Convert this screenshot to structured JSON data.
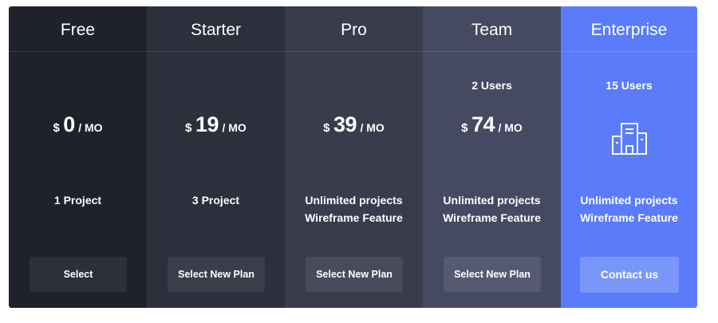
{
  "plans": [
    {
      "name": "Free",
      "users": "",
      "currency": "$",
      "amount": "0",
      "period": "/ MO",
      "features": [
        "1 Project"
      ],
      "button_label": "Select"
    },
    {
      "name": "Starter",
      "users": "",
      "currency": "$",
      "amount": "19",
      "period": "/ MO",
      "features": [
        "3 Project"
      ],
      "button_label": "Select New Plan"
    },
    {
      "name": "Pro",
      "users": "",
      "currency": "$",
      "amount": "39",
      "period": "/ MO",
      "features": [
        "Unlimited projects",
        "Wireframe Feature"
      ],
      "button_label": "Select New Plan"
    },
    {
      "name": "Team",
      "users": "2 Users",
      "currency": "$",
      "amount": "74",
      "period": "/ MO",
      "features": [
        "Unlimited projects",
        "Wireframe Feature"
      ],
      "button_label": "Select New Plan"
    },
    {
      "name": "Enterprise",
      "users": "15 Users",
      "icon": "building-icon",
      "features": [
        "Unlimited projects",
        "Wireframe Feature"
      ],
      "button_label": "Contact us"
    }
  ],
  "colors": {
    "free_bg": "#1f222b",
    "starter_bg": "#2c303c",
    "pro_bg": "#383c4c",
    "team_bg": "#454a62",
    "enterprise_bg": "#5a7cfa",
    "enterprise_button": "#7a96fb"
  }
}
